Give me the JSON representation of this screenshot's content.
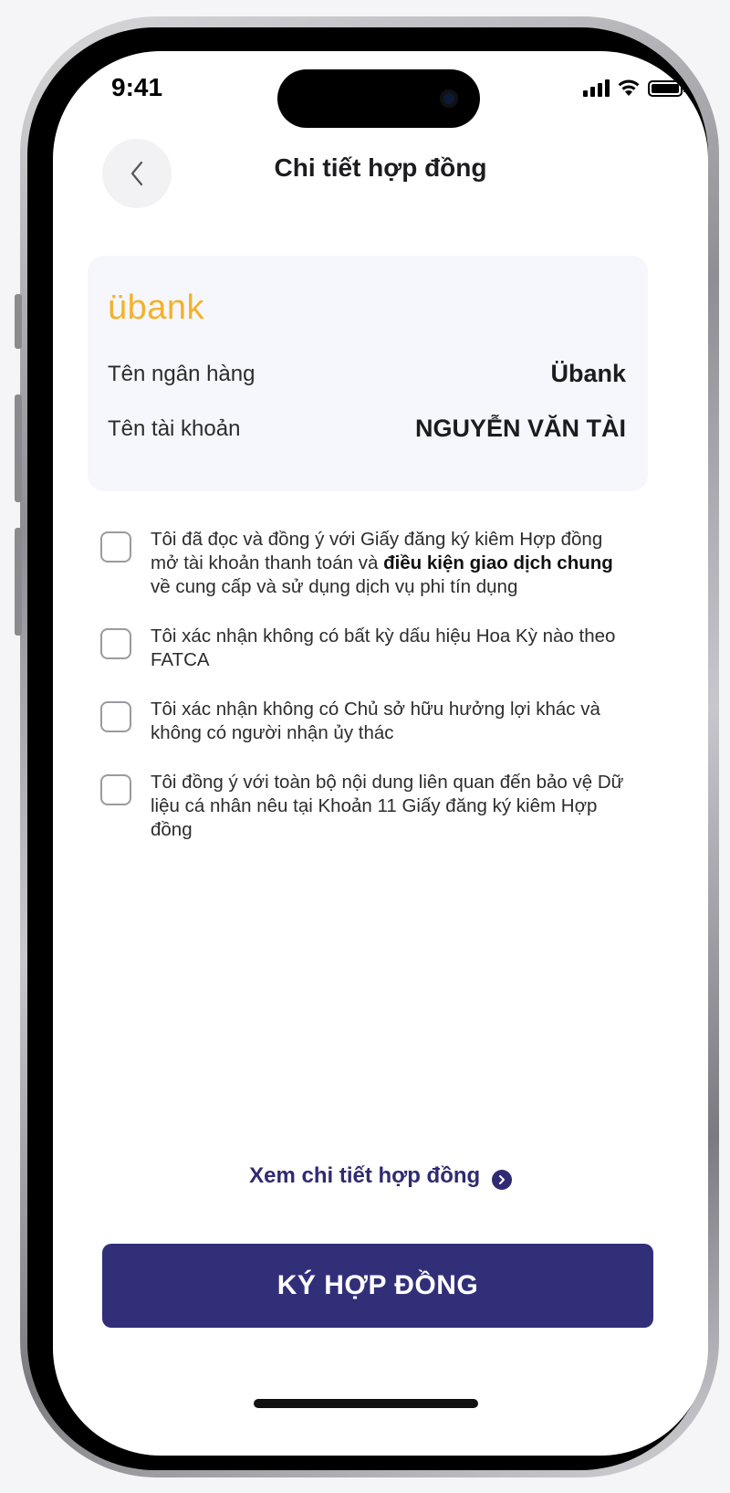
{
  "status_bar": {
    "time": "9:41"
  },
  "header": {
    "title": "Chi tiết hợp đồng"
  },
  "bank_card": {
    "logo_text": "übank",
    "rows": [
      {
        "label": "Tên ngân hàng",
        "value": "Übank"
      },
      {
        "label": "Tên tài khoản",
        "value": "NGUYỄN VĂN TÀI"
      }
    ]
  },
  "terms": [
    {
      "text_a": "Tôi đã đọc và đồng ý với Giấy đăng ký kiêm Hợp đồng mở tài khoản thanh toán và ",
      "bold": "điều kiện giao dịch chung",
      "text_b": " về cung cấp và sử dụng dịch vụ phi tín dụng",
      "checked": false
    },
    {
      "text_a": "Tôi xác nhận không có bất kỳ dấu hiệu Hoa Kỳ nào theo FATCA",
      "checked": false
    },
    {
      "text_a": "Tôi xác nhận không có Chủ sở hữu hưởng lợi khác và không có người nhận ủy thác",
      "checked": false
    },
    {
      "text_a": "Tôi đồng ý với toàn bộ nội dung liên quan đến bảo vệ Dữ liệu cá nhân nêu tại Khoản 11 Giấy đăng ký kiêm Hợp đồng",
      "checked": false
    }
  ],
  "footer": {
    "view_contract_link": "Xem chi tiết hợp đồng",
    "sign_button": "KÝ HỢP ĐỒNG"
  },
  "colors": {
    "primary": "#322f79",
    "logo": "#f4b12a",
    "card_bg": "#f6f7fc"
  }
}
